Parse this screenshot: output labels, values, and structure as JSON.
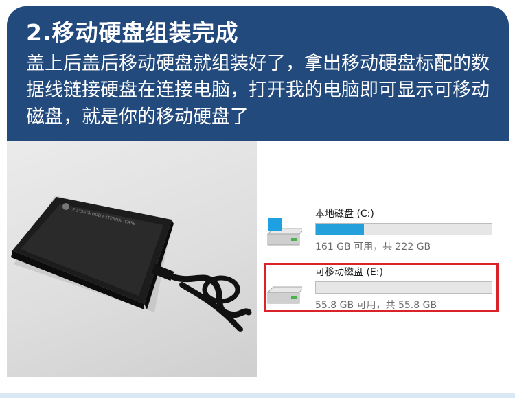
{
  "header": {
    "title": "2.移动硬盘组装完成",
    "description": "盖上后盖后移动硬盘就组装好了，拿出移动硬盘标配的数据线链接硬盘在连接电脑，打开我的电脑即可显示可移动磁盘，就是你的移动硬盘了"
  },
  "photo": {
    "case_label": "2.5\"SATA HDD EXTERNAL CASE"
  },
  "drives": [
    {
      "name": "本地磁盘 (C:)",
      "space": "161 GB 可用，共 222 GB",
      "used_fraction": 0.275,
      "icon": "windows-drive-icon"
    },
    {
      "name": "可移动磁盘 (E:)",
      "space": "55.8 GB 可用，共 55.8 GB",
      "used_fraction": 0.0,
      "icon": "removable-drive-icon",
      "highlighted": true
    }
  ],
  "colors": {
    "header_bg": "#234a7c",
    "highlight_border": "#d9232a",
    "bar_fill": "#26a0da"
  }
}
